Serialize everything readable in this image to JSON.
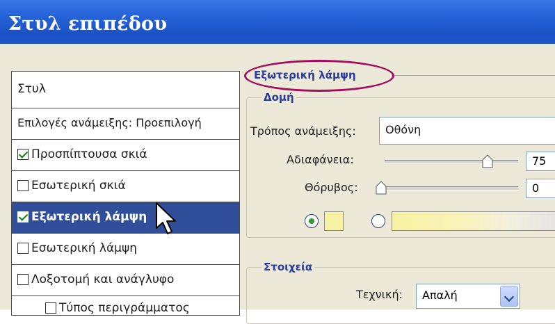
{
  "window": {
    "title": "Στυλ επιπέδου"
  },
  "style_list": {
    "header": "Στυλ",
    "blending_options": "Επιλογές ανάμειξης: Προεπιλογή",
    "items": [
      {
        "label": "Προσπίπτουσα σκιά",
        "checked": true
      },
      {
        "label": "Εσωτερική σκιά",
        "checked": false
      },
      {
        "label": "Εξωτερική λάμψη",
        "checked": true,
        "selected": true
      },
      {
        "label": "Εσωτερική λάμψη",
        "checked": false
      },
      {
        "label": "Λοξοτομή και ανάγλυφο",
        "checked": false
      },
      {
        "label": "Τύπος περιγράμματος",
        "checked": false
      }
    ]
  },
  "panel": {
    "section_title": "Εξωτερική λάμψη",
    "structure": {
      "title": "Δομή",
      "blend_mode_label": "Τρόπος ανάμειξης:",
      "blend_mode_value": "Οθόνη",
      "opacity_label": "Αδιαφάνεια:",
      "opacity_value": "75",
      "noise_label": "Θόρυβος:",
      "noise_value": "0"
    },
    "elements": {
      "title": "Στοιχεία",
      "technique_label": "Τεχνική:",
      "technique_value": "Απαλή"
    }
  },
  "colors": {
    "title_bar": "#2763d9",
    "selected_row": "#314e9a",
    "group_title": "#2a3c9c",
    "highlight_ellipse": "#a40d5e",
    "glow_color": "#f7f1a3"
  },
  "icons": [
    "cursor-arrow-icon",
    "dropdown-arrow-icon"
  ]
}
